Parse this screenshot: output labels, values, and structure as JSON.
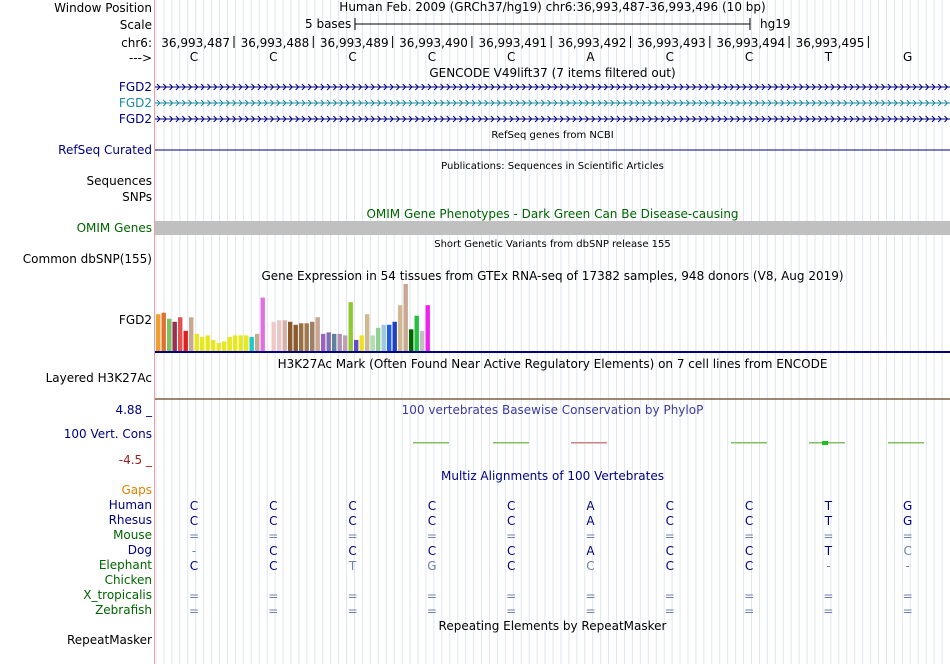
{
  "header": {
    "window_position_label": "Window Position",
    "window_position_text": "Human Feb. 2009 (GRCh37/hg19)   chr6:36,993,487-36,993,496 (10 bp)",
    "scale_label": "Scale",
    "scale_text": "5 bases",
    "assembly": "hg19",
    "chrom_label": "chr6:",
    "strand_label": "--->",
    "positions": [
      "36,993,487",
      "36,993,488",
      "36,993,489",
      "36,993,490",
      "36,993,491",
      "36,993,492",
      "36,993,493",
      "36,993,494",
      "36,993,495"
    ],
    "bases": [
      "C",
      "C",
      "C",
      "C",
      "C",
      "A",
      "C",
      "C",
      "T",
      "G"
    ]
  },
  "tracks": {
    "gencode": {
      "title": "GENCODE V49lift37 (7 items filtered out)",
      "items": [
        "FGD2",
        "FGD2",
        "FGD2"
      ]
    },
    "refseq": {
      "title": "RefSeq genes from NCBI",
      "label": "RefSeq Curated"
    },
    "publications": {
      "title": "Publications: Sequences in Scientific Articles",
      "label1": "Sequences",
      "label2": "SNPs"
    },
    "omim": {
      "title": "OMIM Gene Phenotypes - Dark Green Can Be Disease-causing",
      "label": "OMIM Genes"
    },
    "dbsnp": {
      "title": "Short Genetic Variants from dbSNP release 155",
      "label": "Common dbSNP(155)"
    },
    "gtex": {
      "title": "Gene Expression in 54 tissues from GTEx RNA-seq of 17382 samples, 948 donors (V8, Aug 2019)",
      "label": "FGD2"
    },
    "h3k27ac": {
      "title": "H3K27Ac Mark (Often Found Near Active Regulatory Elements) on 7 cell lines from ENCODE",
      "label": "Layered H3K27Ac"
    },
    "conservation": {
      "title": "100 vertebrates Basewise Conservation by PhyloP",
      "label": "100 Vert. Cons",
      "max": "4.88 _",
      "min": "-4.5 _"
    },
    "multiz": {
      "title": "Multiz Alignments of 100 Vertebrates",
      "species": [
        {
          "name": "Gaps",
          "color": "#e08000",
          "bases": [
            "",
            "",
            "",
            "",
            "",
            "",
            "",
            "",
            "",
            ""
          ]
        },
        {
          "name": "Human",
          "color": "#000080",
          "bases": [
            "C",
            "C",
            "C",
            "C",
            "C",
            "A",
            "C",
            "C",
            "T",
            "G"
          ]
        },
        {
          "name": "Rhesus",
          "color": "#000080",
          "bases": [
            "C",
            "C",
            "C",
            "C",
            "C",
            "A",
            "C",
            "C",
            "T",
            "G"
          ]
        },
        {
          "name": "Mouse",
          "color": "#006400",
          "bases": [
            "=",
            "=",
            "=",
            "=",
            "=",
            "=",
            "=",
            "=",
            "=",
            "="
          ]
        },
        {
          "name": "Dog",
          "color": "#000080",
          "bases": [
            "-",
            "C",
            "C",
            "C",
            "C",
            "A",
            "C",
            "C",
            "T",
            "C"
          ]
        },
        {
          "name": "Elephant",
          "color": "#006400",
          "bases": [
            "C",
            "C",
            "T",
            "G",
            "C",
            "C",
            "C",
            "C",
            "-",
            "-"
          ]
        },
        {
          "name": "Chicken",
          "color": "#006400",
          "bases": [
            "",
            "",
            "",
            "",
            "",
            "",
            "",
            "",
            "",
            ""
          ]
        },
        {
          "name": "X_tropicalis",
          "color": "#006400",
          "bases": [
            "=",
            "=",
            "=",
            "=",
            "=",
            "=",
            "=",
            "=",
            "=",
            "="
          ]
        },
        {
          "name": "Zebrafish",
          "color": "#006400",
          "bases": [
            "=",
            "=",
            "=",
            "=",
            "=",
            "=",
            "=",
            "=",
            "=",
            "="
          ]
        }
      ]
    },
    "repeatmasker": {
      "title": "Repeating Elements by RepeatMasker",
      "label": "RepeatMasker"
    }
  },
  "chart_data": {
    "type": "bar",
    "title": "Gene Expression in 54 tissues from GTEx RNA-seq of 17382 samples, 948 donors (V8, Aug 2019)",
    "values": [
      2.5,
      2.6,
      2.2,
      2.0,
      2.3,
      1.4,
      2.3,
      1.2,
      1.0,
      1.1,
      0.8,
      0.6,
      0.7,
      1.0,
      1.1,
      1.1,
      1.1,
      1.0,
      1.2,
      3.6,
      0,
      2.0,
      2.1,
      2.1,
      2.0,
      1.8,
      1.9,
      1.9,
      2.0,
      2.3,
      1.2,
      1.3,
      1.2,
      1.2,
      1.1,
      3.3,
      0.8,
      1.1,
      2.5,
      1.1,
      1.6,
      1.8,
      1.8,
      2.0,
      3.1,
      4.5,
      1.5,
      2.4,
      1.4,
      3.1,
      0,
      0,
      0,
      0
    ],
    "colors": [
      "#f0a030",
      "#e07030",
      "#80c060",
      "#9b2f4e",
      "#e05050",
      "#e02020",
      "#c8a890",
      "#e8e820",
      "#e8e820",
      "#e8e820",
      "#e8e820",
      "#e8e820",
      "#e8e820",
      "#e8e820",
      "#e8e820",
      "#e8e820",
      "#e8e820",
      "#20c8c8",
      "#c8a890",
      "#e070e0",
      "#ffffff",
      "#f0c8c8",
      "#e8c8c8",
      "#d8b0a8",
      "#8b5a2b",
      "#8b5a2b",
      "#9b7040",
      "#a07850",
      "#a08060",
      "#c8a890",
      "#a060c0",
      "#8070b0",
      "#6080a0",
      "#b090b0",
      "#c0a0b0",
      "#90c830",
      "#6050c8",
      "#f0e020",
      "#d0b890",
      "#b0e0b0",
      "#90d090",
      "#a0c8e0",
      "#2060e0",
      "#2040c0",
      "#d0b890",
      "#c8a890",
      "#006400",
      "#20c040",
      "#c0c0c0",
      "#f020f0",
      "#ffffff",
      "#ffffff",
      "#ffffff",
      "#ffffff"
    ],
    "ylim": [
      0,
      4.5
    ]
  }
}
